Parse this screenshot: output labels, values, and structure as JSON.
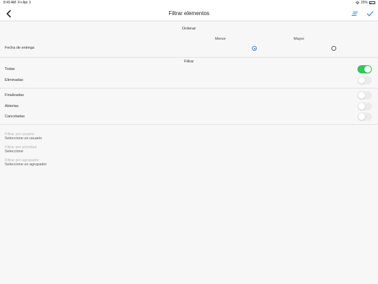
{
  "status_bar": {
    "time": "8:49 AM",
    "date": "Fri Apr 3",
    "battery_text": "25%",
    "battery_level": 0.25
  },
  "nav": {
    "title": "Filtrar elementos",
    "back_icon": "chevron-left-icon",
    "sort_icon": "sort-icon",
    "confirm_icon": "checkmark-icon",
    "accent_color": "#2f80d6"
  },
  "order": {
    "header": "Ordenar",
    "columns": [
      "Menor",
      "Mayor"
    ],
    "row_label": "Fecha de entrega",
    "selected": "Menor"
  },
  "filter": {
    "header": "Filtrar",
    "toggles": [
      {
        "label": "Todas",
        "on": true
      },
      {
        "label": "Eliminadas",
        "on": false
      },
      {
        "label": "Finalizadas",
        "on": false
      },
      {
        "label": "Abiertas",
        "on": false
      },
      {
        "label": "Canceladas",
        "on": false
      }
    ],
    "toggle_on_color": "#34c759"
  },
  "fields": [
    {
      "placeholder": "Filtrar por usuario",
      "value": "Seleccione un usuario"
    },
    {
      "placeholder": "Filtrar por prioridad",
      "value": "Seleccione"
    },
    {
      "placeholder": "Filtrar por agrupador",
      "value": "Seleccione un agrupador"
    }
  ]
}
